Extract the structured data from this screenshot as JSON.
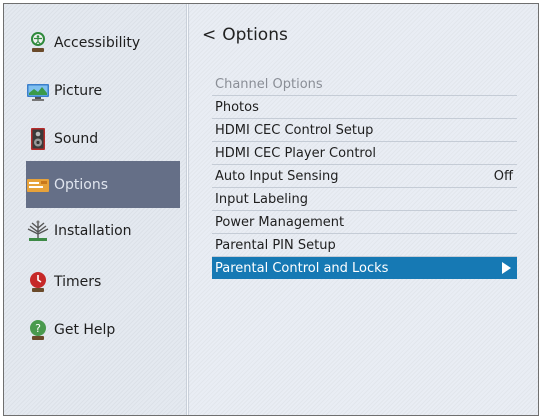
{
  "sidebar": {
    "items": [
      {
        "label": "Accessibility",
        "icon": "accessibility-icon"
      },
      {
        "label": "Picture",
        "icon": "picture-monitor-icon"
      },
      {
        "label": "Sound",
        "icon": "speaker-icon"
      },
      {
        "label": "Options",
        "icon": "options-icon",
        "active": true
      },
      {
        "label": "Installation",
        "icon": "antenna-icon"
      },
      {
        "label": "Timers",
        "icon": "timer-icon"
      },
      {
        "label": "Get Help",
        "icon": "help-icon"
      }
    ]
  },
  "main": {
    "title": "Options",
    "back_glyph": "<",
    "options": [
      {
        "label": "Channel Options",
        "value": "",
        "disabled": true
      },
      {
        "label": "Photos",
        "value": ""
      },
      {
        "label": "HDMI CEC Control Setup",
        "value": ""
      },
      {
        "label": "HDMI CEC Player Control",
        "value": ""
      },
      {
        "label": "Auto Input Sensing",
        "value": "Off"
      },
      {
        "label": "Input Labeling",
        "value": ""
      },
      {
        "label": "Power Management",
        "value": ""
      },
      {
        "label": "Parental PIN Setup",
        "value": ""
      },
      {
        "label": "Parental Control and Locks",
        "value": "",
        "selected": true
      }
    ]
  },
  "colors": {
    "selected_row": "#1679b4",
    "active_sidebar": "#656f87",
    "disabled_text": "#8a8e96"
  }
}
